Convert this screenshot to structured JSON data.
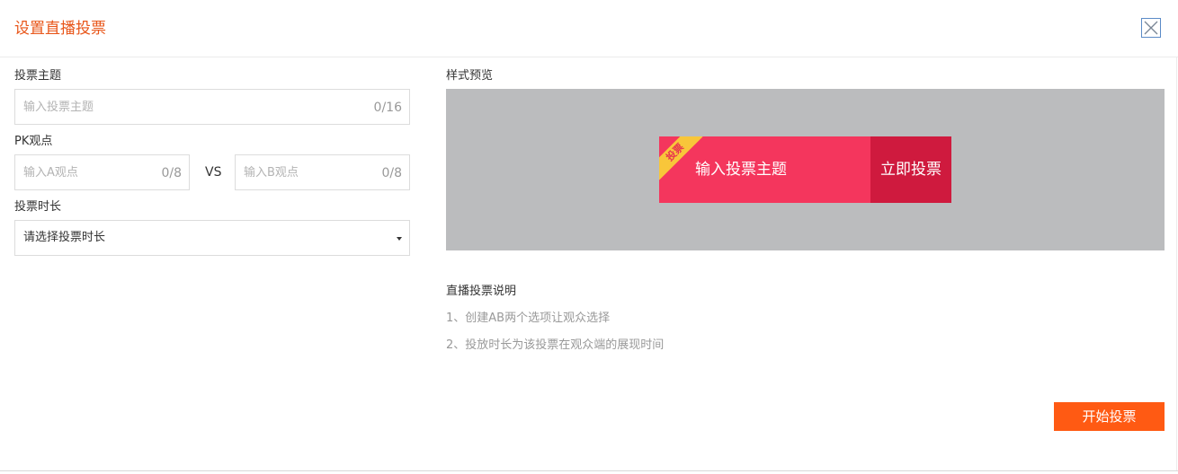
{
  "dialog": {
    "title": "设置直播投票",
    "title_color": "#e8561a",
    "close_icon": "close-x-icon"
  },
  "form": {
    "topic": {
      "label": "投票主题",
      "placeholder": "输入投票主题",
      "value": "",
      "counter": "0/16"
    },
    "pk": {
      "label": "PK观点",
      "a_placeholder": "输入A观点",
      "a_value": "",
      "a_counter": "0/8",
      "vs": "VS",
      "b_placeholder": "输入B观点",
      "b_value": "",
      "b_counter": "0/8"
    },
    "duration": {
      "label": "投票时长",
      "selected": "请选择投票时长"
    }
  },
  "preview": {
    "label": "样式预览",
    "ribbon": "投票",
    "topic": "输入投票主题",
    "button": "立即投票",
    "colors": {
      "background": "#bbbcbe",
      "banner": "#f4365d",
      "button": "#cf1a3e",
      "ribbon": "#f8c63a"
    }
  },
  "notes": {
    "title": "直播投票说明",
    "items": [
      "1、创建AB两个选项让观众选择",
      "2、投放时长为该投票在观众端的展现时间"
    ]
  },
  "actions": {
    "start": "开始投票",
    "start_color": "#ff5a13"
  }
}
